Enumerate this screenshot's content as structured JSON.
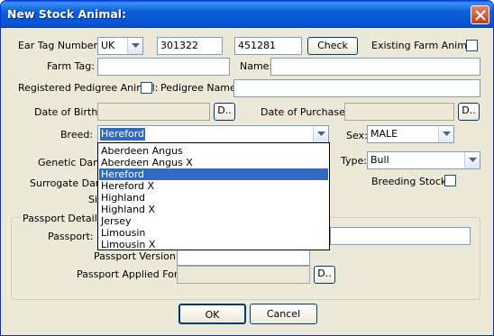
{
  "window": {
    "title": "New Stock Animal:"
  },
  "labels": {
    "ear_tag_number": "Ear Tag Number:",
    "existing_farm_animal": "Existing Farm Animal:",
    "farm_tag": "Farm Tag:",
    "name": "Name:",
    "registered_pedigree": "Registered Pedigree Animal:",
    "pedigree_name": "Pedigree Name:",
    "date_of_birth": "Date of Birth:",
    "date_of_purchase": "Date of Purchase:",
    "breed": "Breed:",
    "sex": "Sex:",
    "genetic_dam": "Genetic Dam",
    "type": "Type:",
    "surrogate_dam": "Surrogate Dam",
    "breeding_stock": "Breeding Stock:",
    "sire_partial": "Si",
    "passport_details": "Passport Details",
    "passport": "Passport:",
    "passport_version": "Passport Version:",
    "passport_applied_for": "Passport Applied For:"
  },
  "fields": {
    "country": "UK",
    "ear_tag_part1": "301322",
    "ear_tag_part2": "451281",
    "farm_tag": "",
    "name": "",
    "pedigree_name": "",
    "date_of_birth": "",
    "date_of_purchase": "",
    "breed": "Hereford",
    "sex": "MALE",
    "type": "Bull",
    "passport": "",
    "passport_version": "",
    "passport_applied_for": ""
  },
  "buttons": {
    "check": "Check",
    "date_picker": "D..",
    "ok": "OK",
    "cancel": "Cancel"
  },
  "breed_options": [
    "Aberdeen Angus",
    "Aberdeen Angus X",
    "Hereford",
    "Hereford X",
    "Highland",
    "Highland X",
    "Jersey",
    "Limousin",
    "Limousin X"
  ],
  "breed_highlighted_index": 2,
  "icons": {
    "close": "close-icon",
    "dropdown": "chevron-down-icon"
  }
}
